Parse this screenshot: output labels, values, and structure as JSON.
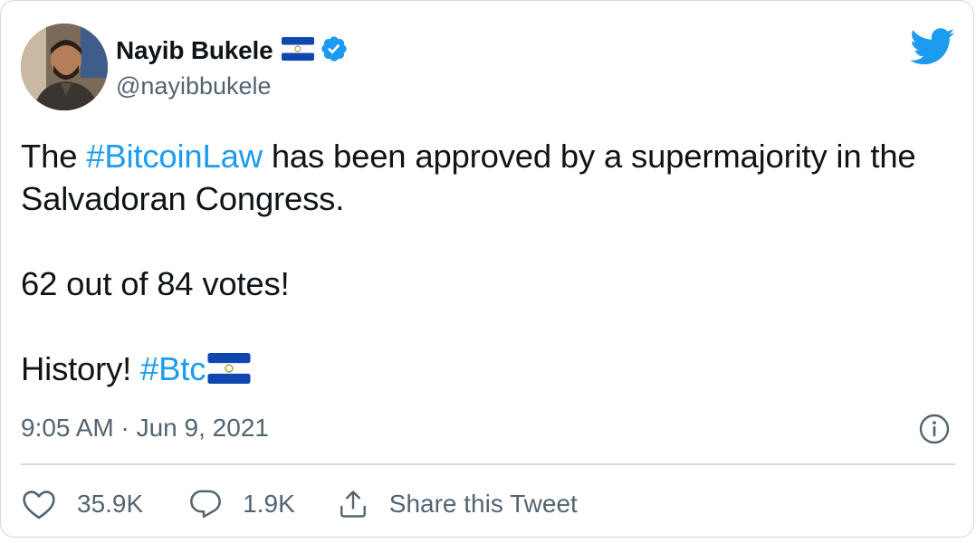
{
  "author": {
    "name": "Nayib Bukele",
    "handle": "@nayibbukele"
  },
  "tweet": {
    "line1_pre": "The ",
    "line1_tag": "#BitcoinLaw",
    "line1_post": " has been approved by a supermajority in the Salvadoran Congress.",
    "line2": "62 out of 84 votes!",
    "line3_pre": "History! ",
    "line3_tag": "#Btc"
  },
  "meta": {
    "timestamp": "9:05 AM · Jun 9, 2021"
  },
  "actions": {
    "likes": "35.9K",
    "replies": "1.9K",
    "share_label": "Share this Tweet"
  },
  "icons": {
    "bird": "twitter-bird-icon",
    "verified": "verified-badge-icon",
    "flag": "el-salvador-flag-icon",
    "info": "info-icon",
    "like": "heart-icon",
    "reply": "reply-icon",
    "share": "share-icon"
  },
  "colors": {
    "accent": "#1d9bf0",
    "text": "#0f1419",
    "secondary": "#536471",
    "border": "#cfd9de"
  }
}
